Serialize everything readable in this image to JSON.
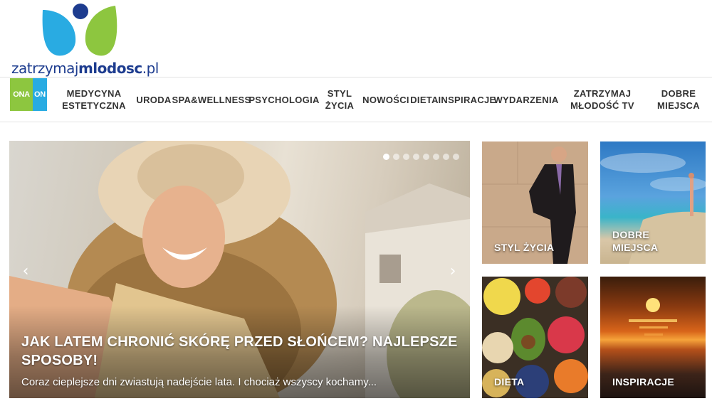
{
  "brand": {
    "name_part1": "zatrzymaj",
    "name_part2": "mlodosc",
    "name_part3": ".pl",
    "colors": {
      "blue": "#29abe2",
      "green": "#8dc63f",
      "navy": "#1d3c8f"
    }
  },
  "nav": {
    "gender_ona": "ONA",
    "gender_on": "ON",
    "items": [
      "MEDYCYNA\nESTETYCZNA",
      "URODA",
      "SPA&WELLNESS",
      "PSYCHOLOGIA",
      "STYL\nŻYCIA",
      "NOWOŚCI",
      "DIETA",
      "INSPIRACJE",
      "WYDARZENIA",
      "ZATRZYMAJ\nMŁODOŚĆ TV",
      "DOBRE\nMIEJSCA"
    ]
  },
  "slider": {
    "title": "JAK LATEM CHRONIĆ SKÓRĘ PRZED SŁOŃCEM? NAJLEPSZE SPOSOBY!",
    "excerpt": "Coraz cieplejsze dni zwiastują nadejście lata. I chociaż wszyscy kochamy...",
    "prev_icon": "chevron-left-icon",
    "next_icon": "chevron-right-icon",
    "slide_count": 8,
    "active_slide": 1
  },
  "tiles": [
    {
      "label": "STYL ŻYCIA"
    },
    {
      "label": "DOBRE\nMIEJSCA"
    },
    {
      "label": "DIETA"
    },
    {
      "label": "INSPIRACJE"
    }
  ]
}
